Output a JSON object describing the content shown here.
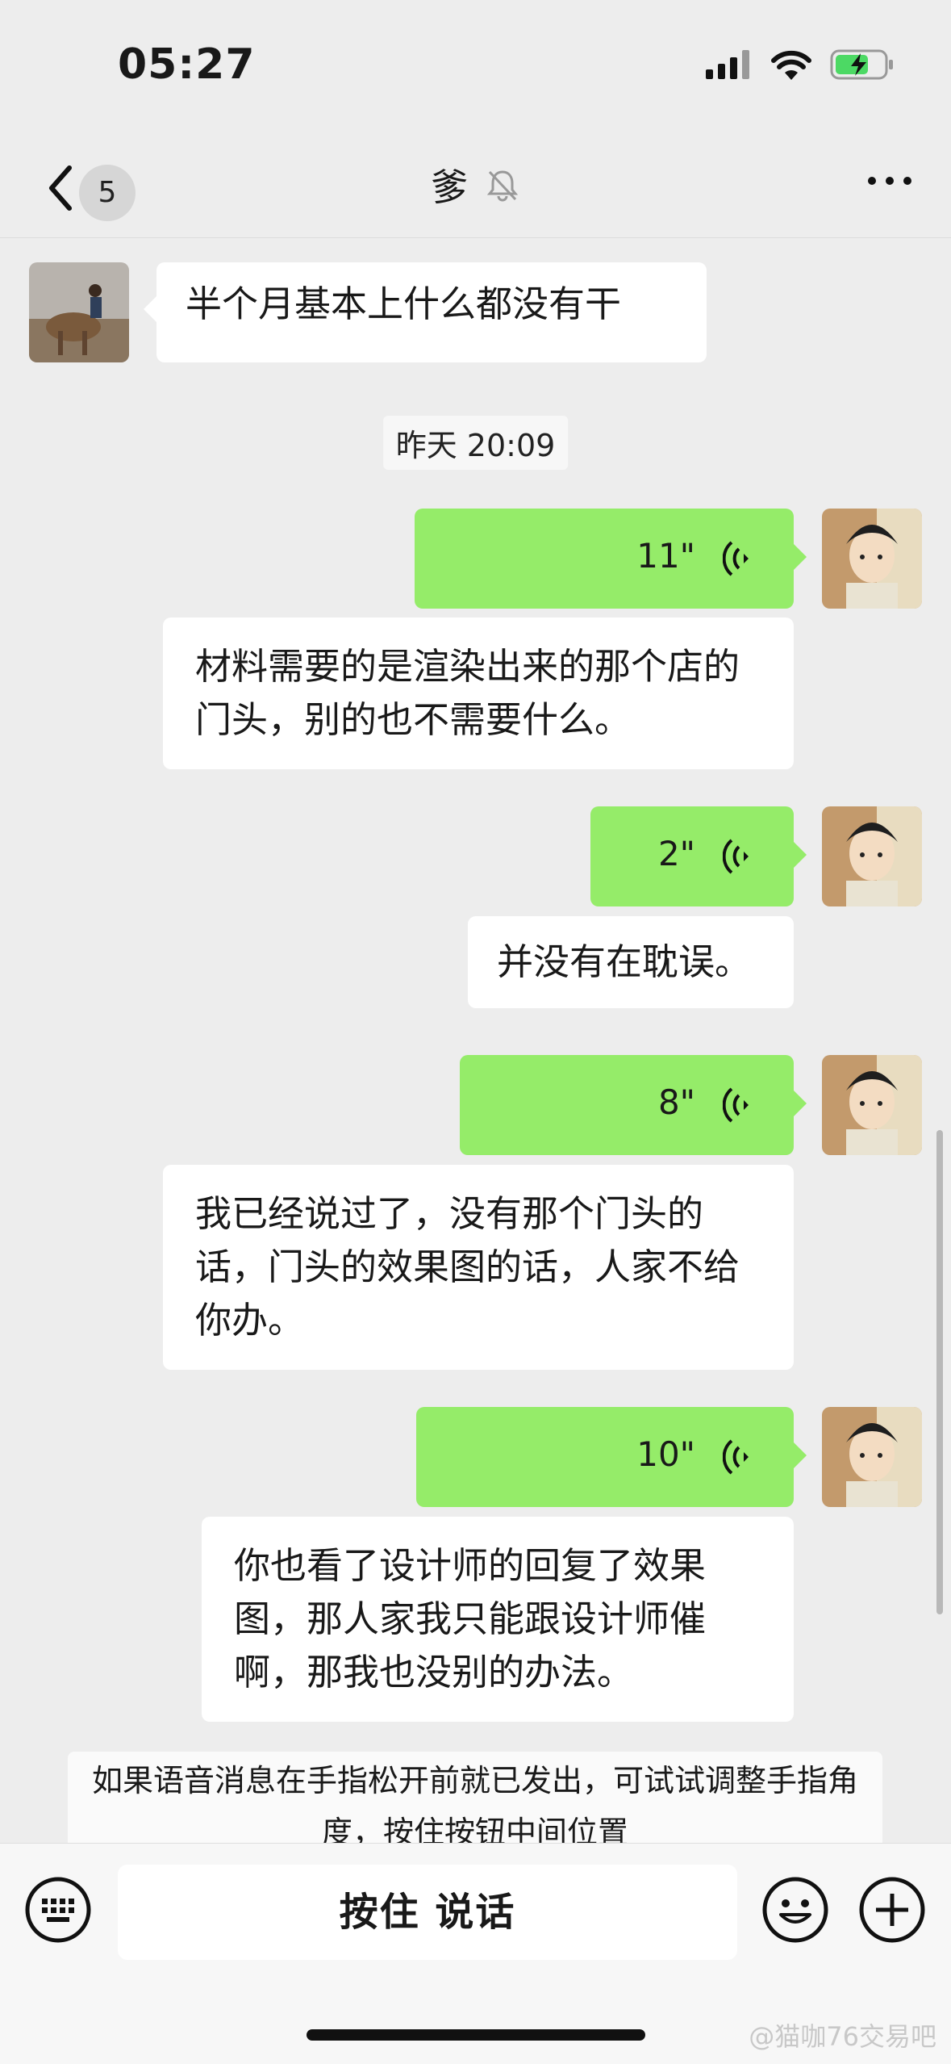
{
  "status_bar": {
    "time": "05:27"
  },
  "nav": {
    "back_badge": "5",
    "title": "爹"
  },
  "chat": {
    "incoming_top": {
      "text": "半个月基本上什么都没有干"
    },
    "timestamp": "昨天 20:09",
    "voice_messages": [
      {
        "duration": "11\"",
        "transcript": "材料需要的是渲染出来的那个店的门头，别的也不需要什么。"
      },
      {
        "duration": "2\"",
        "transcript": "并没有在耽误。"
      },
      {
        "duration": "8\"",
        "transcript": "我已经说过了，没有那个门头的话，门头的效果图的话，人家不给你办。"
      },
      {
        "duration": "10\"",
        "transcript": "你也看了设计师的回复了效果图，那人家我只能跟设计师催啊，那我也没别的办法。"
      }
    ]
  },
  "tip": {
    "text": "如果语音消息在手指松开前就已发出，可试试调整手指角度，按住按钮中间位置"
  },
  "input_bar": {
    "hold_to_talk": "按住 说话"
  },
  "watermark": "@猫咖76交易吧",
  "colors": {
    "outgoing_bubble": "#95ec69",
    "background": "#ededed",
    "incoming_bubble": "#ffffff"
  },
  "icons": [
    "back-chevron-icon",
    "mute-bell-icon",
    "more-icon",
    "signal-icon",
    "wifi-icon",
    "battery-charging-icon",
    "voice-wave-icon",
    "keyboard-icon",
    "emoji-icon",
    "plus-icon"
  ]
}
